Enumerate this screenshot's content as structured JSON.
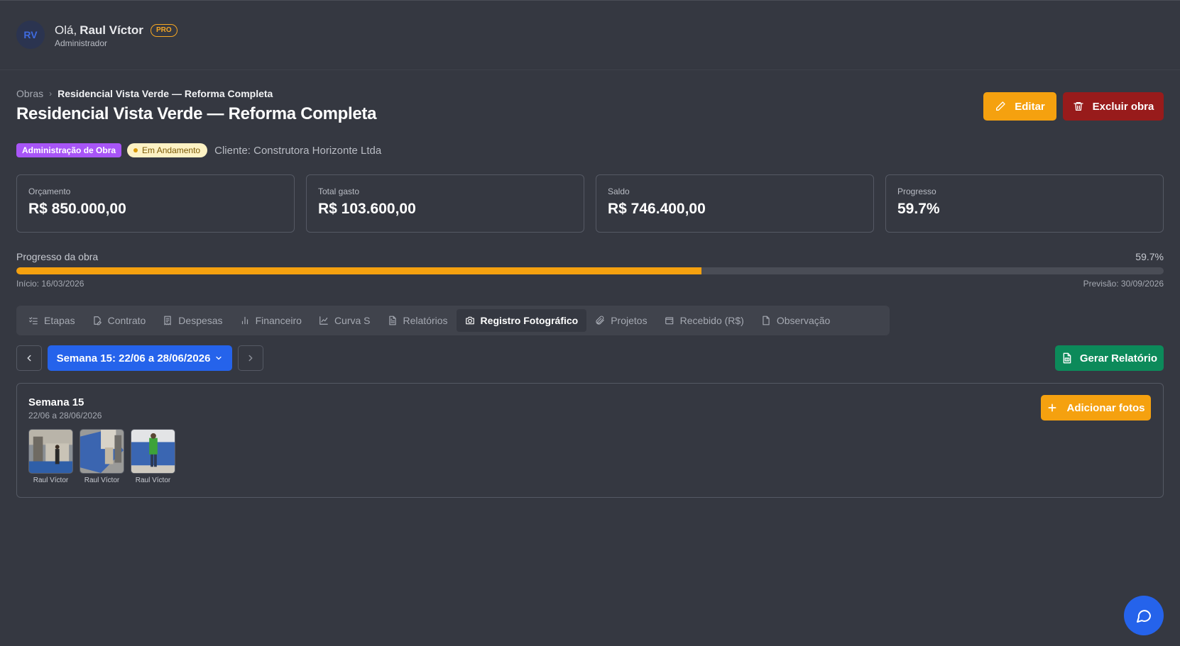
{
  "user": {
    "initials": "RV",
    "greeting": "Olá,",
    "name": "Raul Víctor",
    "plan": "PRO",
    "role": "Administrador"
  },
  "breadcrumb": {
    "root": "Obras",
    "current": "Residencial Vista Verde — Reforma Completa"
  },
  "page": {
    "title": "Residencial Vista Verde — Reforma Completa"
  },
  "actions": {
    "edit_label": "Editar",
    "delete_label": "Excluir obra"
  },
  "tags": {
    "type": "Administração de Obra",
    "status": "Em Andamento",
    "client": "Cliente: Construtora Horizonte Ltda"
  },
  "cards": [
    {
      "label": "Orçamento",
      "value": "R$ 850.000,00"
    },
    {
      "label": "Total gasto",
      "value": "R$ 103.600,00"
    },
    {
      "label": "Saldo",
      "value": "R$ 746.400,00"
    },
    {
      "label": "Progresso",
      "value": "59.7%"
    }
  ],
  "progress": {
    "label": "Progresso da obra",
    "percent_text": "59.7%",
    "percent": 59.7,
    "start": "Início: 16/03/2026",
    "end": "Previsão: 30/09/2026"
  },
  "tabs": [
    {
      "label": "Etapas",
      "icon": "list-checks-icon"
    },
    {
      "label": "Contrato",
      "icon": "file-pen-icon"
    },
    {
      "label": "Despesas",
      "icon": "receipt-icon"
    },
    {
      "label": "Financeiro",
      "icon": "bar-chart-icon"
    },
    {
      "label": "Curva S",
      "icon": "line-chart-icon"
    },
    {
      "label": "Relatórios",
      "icon": "file-text-icon"
    },
    {
      "label": "Registro Fotográfico",
      "icon": "camera-icon",
      "active": true
    },
    {
      "label": "Projetos",
      "icon": "paperclip-icon"
    },
    {
      "label": "Recebido (R$)",
      "icon": "wallet-icon"
    },
    {
      "label": "Observação",
      "icon": "file-icon"
    }
  ],
  "week_nav": {
    "selected": "Semana 15: 22/06 a 28/06/2026",
    "report_label": "Gerar Relatório"
  },
  "week_panel": {
    "title": "Semana 15",
    "range": "22/06 a 28/06/2026",
    "add_label": "Adicionar fotos",
    "photos": [
      {
        "author": "Raul Víctor"
      },
      {
        "author": "Raul Víctor"
      },
      {
        "author": "Raul Víctor"
      }
    ]
  },
  "colors": {
    "background": "#353841",
    "accent_orange": "#f5a10f",
    "danger": "#981b1b",
    "primary_blue": "#2563eb",
    "success_green": "#0c8a5a",
    "admin_purple": "#a855f7"
  }
}
